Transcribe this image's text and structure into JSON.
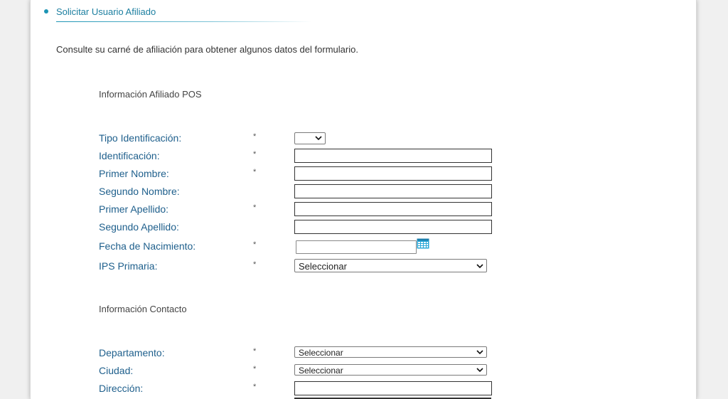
{
  "header": {
    "section_title": "Solicitar Usuario Afiliado"
  },
  "intro_text": "Consulte su carné de afiliación para obtener algunos datos del formulario.",
  "sections": {
    "pos_title": "Información Afiliado POS",
    "contact_title": "Información Contacto"
  },
  "form": {
    "required_mark": "*",
    "tipo_identificacion": {
      "label": "Tipo Identificación:",
      "value": ""
    },
    "identificacion": {
      "label": "Identificación:",
      "value": ""
    },
    "primer_nombre": {
      "label": "Primer Nombre:",
      "value": ""
    },
    "segundo_nombre": {
      "label": "Segundo Nombre:",
      "value": ""
    },
    "primer_apellido": {
      "label": "Primer Apellido:",
      "value": ""
    },
    "segundo_apellido": {
      "label": "Segundo Apellido:",
      "value": ""
    },
    "fecha_nacimiento": {
      "label": "Fecha de Nacimiento:",
      "value": ""
    },
    "ips_primaria": {
      "label": "IPS Primaria:",
      "value": "Seleccionar"
    },
    "departamento": {
      "label": "Departamento:",
      "value": "Seleccionar"
    },
    "ciudad": {
      "label": "Ciudad:",
      "value": "Seleccionar"
    },
    "direccion": {
      "label": "Dirección:",
      "value": ""
    }
  },
  "icons": {
    "bullet": "bullet-icon",
    "calendar": "calendar-icon",
    "dropdown": "chevron-down-icon"
  },
  "colors": {
    "accent": "#1c94b4",
    "label": "#1e5f8c",
    "calendar": "#2aa8d8"
  }
}
